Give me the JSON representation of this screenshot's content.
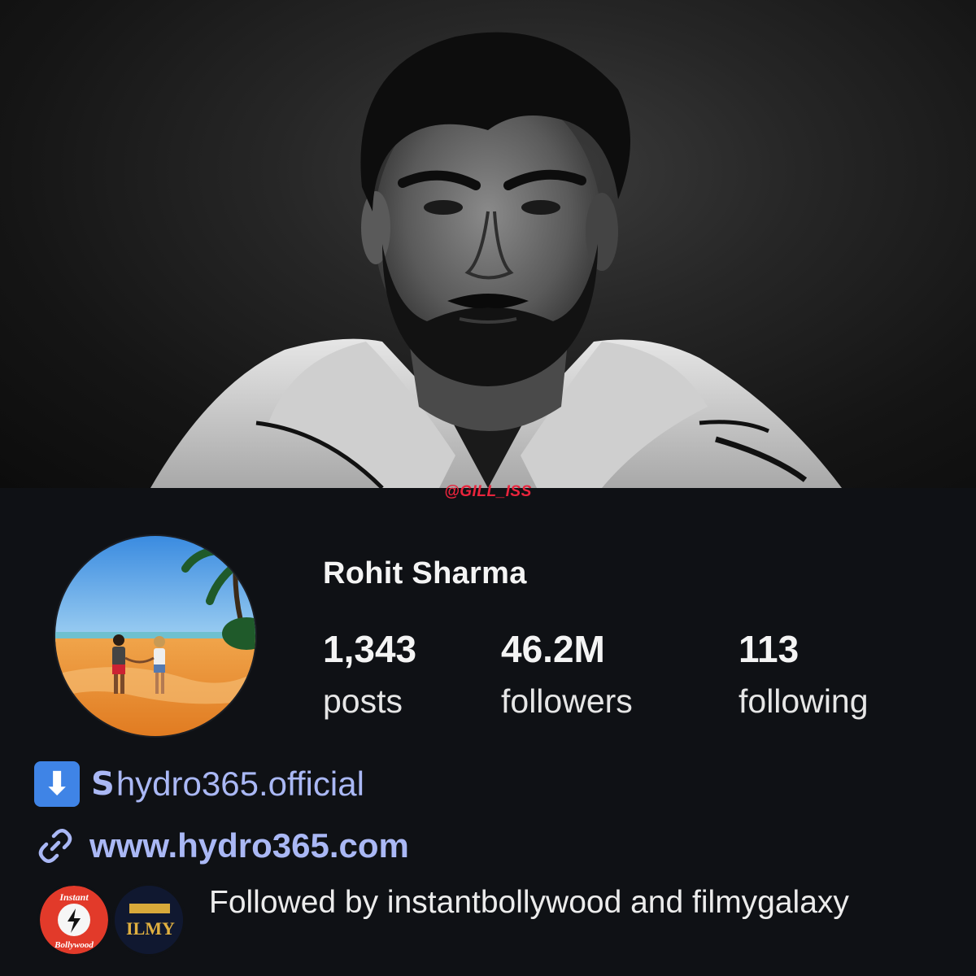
{
  "watermark": "@GILL_ISS",
  "profile": {
    "name": "Rohit Sharma",
    "stats": [
      {
        "value": "1,343",
        "label": "posts"
      },
      {
        "value": "46.2M",
        "label": "followers"
      },
      {
        "value": "113",
        "label": "following"
      }
    ],
    "bio": {
      "arrow_emoji": "⬇",
      "threads_icon": "threads-icon",
      "threads_handle": "hydro365.official",
      "link_icon": "link-icon",
      "website": "www.hydro365.com"
    },
    "followed_by": {
      "text": "Followed by instantbollywood and filmygalaxy",
      "avatars": [
        {
          "name": "instantbollywood",
          "logo_text_top": "Instant",
          "logo_text_bottom": "Bollywood"
        },
        {
          "name": "filmygalaxy",
          "logo_text": "ILMY"
        }
      ]
    }
  },
  "colors": {
    "background": "#0f1115",
    "link": "#aab8f5",
    "watermark": "#e8243c",
    "emoji_blue": "#3f84e6"
  }
}
